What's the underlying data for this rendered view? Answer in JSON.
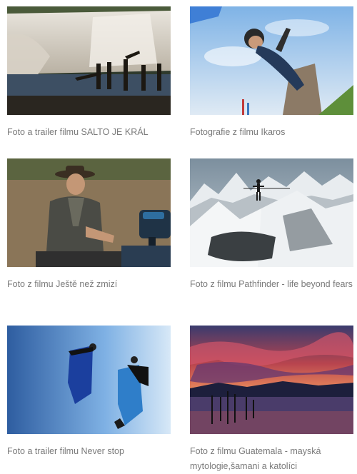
{
  "gallery": {
    "items": [
      {
        "caption": "Foto a trailer filmu SALTO JE KRÁL"
      },
      {
        "caption": "Fotografie z filmu Ikaros"
      },
      {
        "caption": "Foto z filmu Ještě než zmizí"
      },
      {
        "caption": "Foto z filmu Pathfinder - life beyond fears"
      },
      {
        "caption": "Foto a trailer filmu Never stop"
      },
      {
        "caption": "Foto z filmu Guatemala - mayská mytologie,šamani a katolíci"
      }
    ]
  }
}
